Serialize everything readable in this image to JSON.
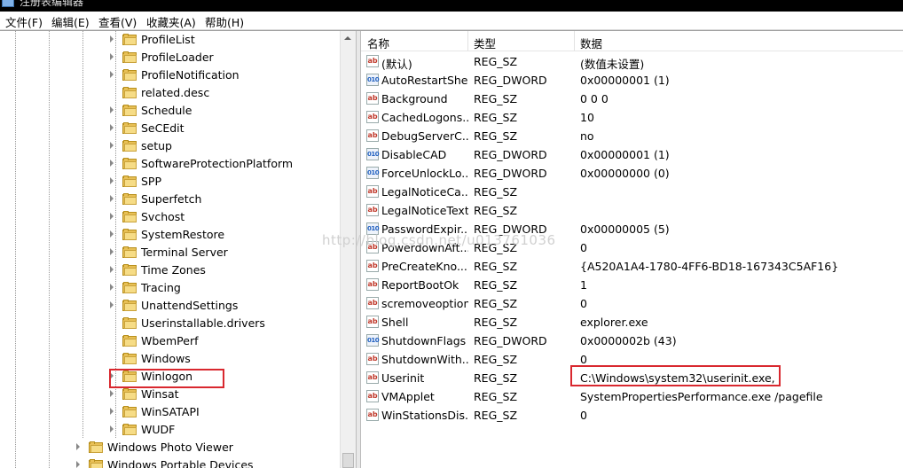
{
  "window": {
    "title": "注册表编辑器"
  },
  "menu": [
    "文件(F)",
    "编辑(E)",
    "查看(V)",
    "收藏夹(A)",
    "帮助(H)"
  ],
  "tree": {
    "items": [
      {
        "label": "ProfileList",
        "expandable": true
      },
      {
        "label": "ProfileLoader",
        "expandable": true
      },
      {
        "label": "ProfileNotification",
        "expandable": true
      },
      {
        "label": "related.desc",
        "expandable": false
      },
      {
        "label": "Schedule",
        "expandable": true
      },
      {
        "label": "SeCEdit",
        "expandable": true
      },
      {
        "label": "setup",
        "expandable": true
      },
      {
        "label": "SoftwareProtectionPlatform",
        "expandable": true
      },
      {
        "label": "SPP",
        "expandable": true
      },
      {
        "label": "Superfetch",
        "expandable": true
      },
      {
        "label": "Svchost",
        "expandable": true
      },
      {
        "label": "SystemRestore",
        "expandable": true
      },
      {
        "label": "Terminal Server",
        "expandable": true
      },
      {
        "label": "Time Zones",
        "expandable": true
      },
      {
        "label": "Tracing",
        "expandable": true
      },
      {
        "label": "UnattendSettings",
        "expandable": true
      },
      {
        "label": "Userinstallable.drivers",
        "expandable": false
      },
      {
        "label": "WbemPerf",
        "expandable": false
      },
      {
        "label": "Windows",
        "expandable": false
      },
      {
        "label": "Winlogon",
        "expandable": true,
        "selected": true
      },
      {
        "label": "Winsat",
        "expandable": true
      },
      {
        "label": "WinSATAPI",
        "expandable": true
      },
      {
        "label": "WUDF",
        "expandable": true
      }
    ],
    "parent_items": [
      {
        "label": "Windows Photo Viewer",
        "expandable": true
      },
      {
        "label": "Windows Portable Devices",
        "expandable": true
      }
    ]
  },
  "list": {
    "headers": {
      "name": "名称",
      "type": "类型",
      "data": "数据"
    },
    "rows": [
      {
        "icon": "string-value-icon",
        "name": "(默认)",
        "type": "REG_SZ",
        "data": "(数值未设置)"
      },
      {
        "icon": "binary-value-icon",
        "name": "AutoRestartShell",
        "type": "REG_DWORD",
        "data": "0x00000001 (1)"
      },
      {
        "icon": "string-value-icon",
        "name": "Background",
        "type": "REG_SZ",
        "data": "0 0 0"
      },
      {
        "icon": "string-value-icon",
        "name": "CachedLogons...",
        "type": "REG_SZ",
        "data": "10"
      },
      {
        "icon": "string-value-icon",
        "name": "DebugServerC...",
        "type": "REG_SZ",
        "data": "no"
      },
      {
        "icon": "binary-value-icon",
        "name": "DisableCAD",
        "type": "REG_DWORD",
        "data": "0x00000001 (1)"
      },
      {
        "icon": "binary-value-icon",
        "name": "ForceUnlockLo...",
        "type": "REG_DWORD",
        "data": "0x00000000 (0)"
      },
      {
        "icon": "string-value-icon",
        "name": "LegalNoticeCa...",
        "type": "REG_SZ",
        "data": ""
      },
      {
        "icon": "string-value-icon",
        "name": "LegalNoticeText",
        "type": "REG_SZ",
        "data": ""
      },
      {
        "icon": "binary-value-icon",
        "name": "PasswordExpir...",
        "type": "REG_DWORD",
        "data": "0x00000005 (5)"
      },
      {
        "icon": "string-value-icon",
        "name": "PowerdownAft...",
        "type": "REG_SZ",
        "data": "0"
      },
      {
        "icon": "string-value-icon",
        "name": "PreCreateKno...",
        "type": "REG_SZ",
        "data": "{A520A1A4-1780-4FF6-BD18-167343C5AF16}"
      },
      {
        "icon": "string-value-icon",
        "name": "ReportBootOk",
        "type": "REG_SZ",
        "data": "1"
      },
      {
        "icon": "string-value-icon",
        "name": "scremoveoption",
        "type": "REG_SZ",
        "data": "0"
      },
      {
        "icon": "string-value-icon",
        "name": "Shell",
        "type": "REG_SZ",
        "data": "explorer.exe"
      },
      {
        "icon": "binary-value-icon",
        "name": "ShutdownFlags",
        "type": "REG_DWORD",
        "data": "0x0000002b (43)"
      },
      {
        "icon": "string-value-icon",
        "name": "ShutdownWith...",
        "type": "REG_SZ",
        "data": "0"
      },
      {
        "icon": "string-value-icon",
        "name": "Userinit",
        "type": "REG_SZ",
        "data": "C:\\Windows\\system32\\userinit.exe,"
      },
      {
        "icon": "string-value-icon",
        "name": "VMApplet",
        "type": "REG_SZ",
        "data": "SystemPropertiesPerformance.exe /pagefile"
      },
      {
        "icon": "string-value-icon",
        "name": "WinStationsDis...",
        "type": "REG_SZ",
        "data": "0"
      }
    ]
  },
  "watermark": "http://blog.csdn.net/u013761036",
  "colors": {
    "highlight": "#d9282f",
    "folder": "#e8c056"
  }
}
